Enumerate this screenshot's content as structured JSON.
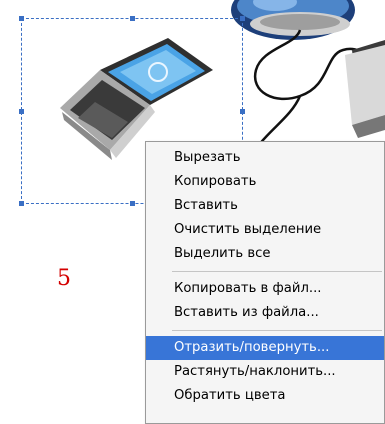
{
  "annotation": {
    "step_number": "5"
  },
  "context_menu": {
    "items": [
      {
        "label": "Вырезать"
      },
      {
        "label": "Копировать"
      },
      {
        "label": "Вставить"
      },
      {
        "label": "Очистить выделение"
      },
      {
        "label": "Выделить все"
      },
      {
        "label": "Копировать в файл..."
      },
      {
        "label": "Вставить из файла..."
      },
      {
        "label": "Отразить/повернуть...",
        "highlighted": true
      },
      {
        "label": "Растянуть/наклонить..."
      },
      {
        "label": "Обратить цвета"
      }
    ]
  },
  "colors": {
    "selection_border": "#3a6fc4",
    "highlight": "#3875d7",
    "step_number": "#d40000"
  }
}
